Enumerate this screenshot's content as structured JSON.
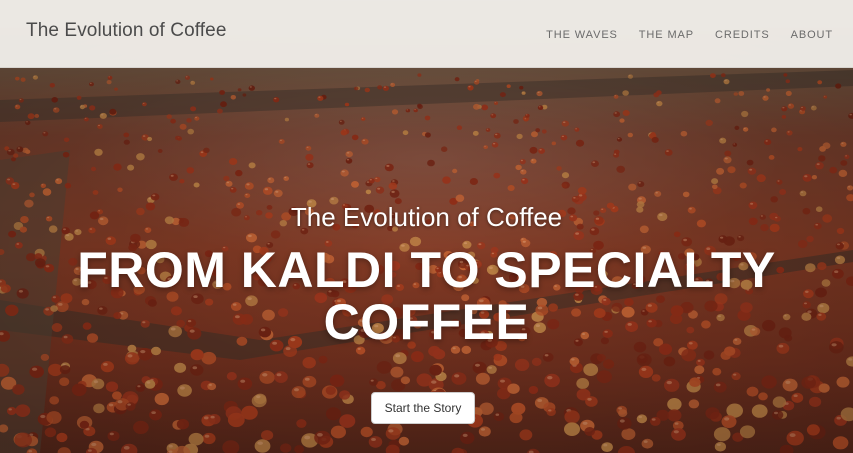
{
  "navbar": {
    "brand": "The Evolution of Coffee",
    "links": [
      {
        "label": "THE WAVES"
      },
      {
        "label": "THE MAP"
      },
      {
        "label": "CREDITS"
      },
      {
        "label": "ABOUT"
      }
    ]
  },
  "hero": {
    "subtitle": "The Evolution of Coffee",
    "title": "FROM KALDI TO SPECIALTY COFFEE",
    "cta_label": "Start the Story",
    "background_image": "coffee-cherries-drying-bed-photo"
  },
  "colors": {
    "navbar_bg": "#f5f3ef",
    "nav_text": "#6b6b6b",
    "brand_text": "#4b4b4b",
    "hero_text": "#ffffff",
    "cherry_red": "#a8391f"
  }
}
